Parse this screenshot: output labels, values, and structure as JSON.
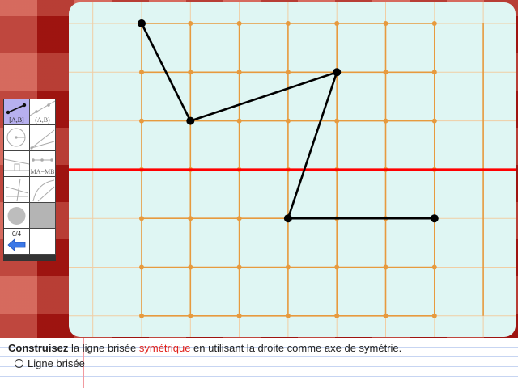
{
  "toolbar": {
    "tools": [
      {
        "id": "segment",
        "label": "[A,B]",
        "icon": "segment-icon",
        "selected": true
      },
      {
        "id": "line",
        "label": "(A,B)",
        "icon": "line-icon"
      },
      {
        "id": "circle",
        "label": "",
        "icon": "circle-icon"
      },
      {
        "id": "ray",
        "label": "",
        "icon": "ray-icon"
      },
      {
        "id": "perpendicular",
        "label": "",
        "icon": "perpendicular-icon"
      },
      {
        "id": "equidistant",
        "label": "MA=MB",
        "icon": "equidistant-icon"
      },
      {
        "id": "angle",
        "label": "",
        "icon": "angle-icon"
      },
      {
        "id": "arc",
        "label": "",
        "icon": "arc-icon"
      },
      {
        "id": "point",
        "label": "",
        "icon": "point-icon"
      },
      {
        "id": "blank",
        "label": "",
        "icon": ""
      },
      {
        "id": "undo",
        "label": "0/4",
        "icon": "undo-arrow-icon"
      },
      {
        "id": "empty",
        "label": "",
        "icon": ""
      }
    ]
  },
  "board": {
    "colors": {
      "background": "#dff6f3",
      "minor_grid": "#f1cda3",
      "major_grid": "#e79a3e",
      "axis": "#ff0000",
      "polyline": "#000000"
    },
    "grid": {
      "columns": 7,
      "rows": 7
    },
    "axis_row": 3,
    "polyline": [
      [
        0,
        0
      ],
      [
        1,
        2
      ],
      [
        4,
        1
      ],
      [
        3,
        4
      ],
      [
        6,
        4
      ]
    ]
  },
  "instruction": {
    "verb": "Construisez",
    "part1": " la ligne brisée ",
    "highlight": "symétrique",
    "part2": " en utilisant la droite comme axe de symétrie.",
    "option_label": "Ligne brisée"
  }
}
